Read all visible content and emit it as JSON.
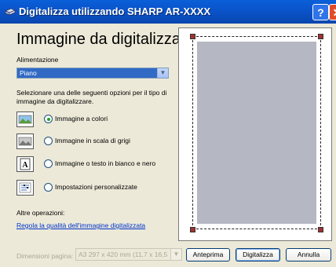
{
  "window": {
    "title": "Digitalizza utilizzando SHARP AR-XXXX",
    "help": "?",
    "close": "✕"
  },
  "left": {
    "heading": "Immagine da digitalizzare:",
    "feed_label": "Alimentazione",
    "feed_value": "Piano",
    "description": "Selezionare una delle seguenti opzioni per il tipo di immagine da digitalizzare.",
    "options": [
      {
        "label": "Immagine a colori",
        "icon": "color-image-icon",
        "selected": true
      },
      {
        "label": "Immagine in scala di grigi",
        "icon": "grayscale-image-icon",
        "selected": false
      },
      {
        "label": "Immagine o testo in bianco e nero",
        "icon": "bw-text-icon",
        "selected": false
      },
      {
        "label": "Impostazioni personalizzate",
        "icon": "custom-settings-icon",
        "selected": false
      }
    ],
    "other_label": "Altre operazioni:",
    "quality_link": "Regola la qualità dell'immagine digitalizzata"
  },
  "bottom": {
    "size_label": "Dimensioni pagina:",
    "size_value": "A3 297 x 420 mm (11,7 x 16,5",
    "preview_button": "Anteprima",
    "scan_button": "Digitalizza",
    "cancel_button": "Annulla"
  },
  "colors": {
    "accent": "#316ac5",
    "title_bar": "#0a52c8",
    "preview_page": "#b5b8c3",
    "link": "#0033cc"
  }
}
